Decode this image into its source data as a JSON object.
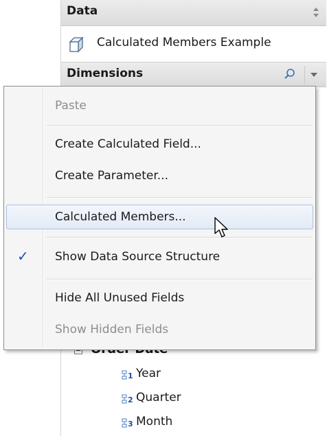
{
  "panel": {
    "title": "Data",
    "datasource": "Calculated Members Example",
    "dimensions_title": "Dimensions"
  },
  "menu": {
    "items": [
      {
        "label": "Paste",
        "enabled": false
      },
      {
        "label": "Create Calculated Field...",
        "enabled": true
      },
      {
        "label": "Create Parameter...",
        "enabled": true
      },
      {
        "label": "Calculated Members...",
        "enabled": true,
        "hovered": true
      },
      {
        "label": "Show Data Source Structure",
        "enabled": true,
        "checked": true
      },
      {
        "label": "Hide All Unused Fields",
        "enabled": true
      },
      {
        "label": "Show Hidden Fields",
        "enabled": false
      }
    ]
  },
  "tree": {
    "group": "Order Date",
    "items": [
      {
        "label": "Year",
        "level_icon": "hierarchy-level-1-icon"
      },
      {
        "label": "Quarter",
        "level_icon": "hierarchy-level-2-icon"
      },
      {
        "label": "Month",
        "level_icon": "hierarchy-level-3-icon"
      }
    ]
  },
  "colors": {
    "check": "#1f4ea8",
    "hover_border": "#a9c0df",
    "disabled_text": "#8d8d8d",
    "hierarchy_icon": "#4a7fc1"
  }
}
